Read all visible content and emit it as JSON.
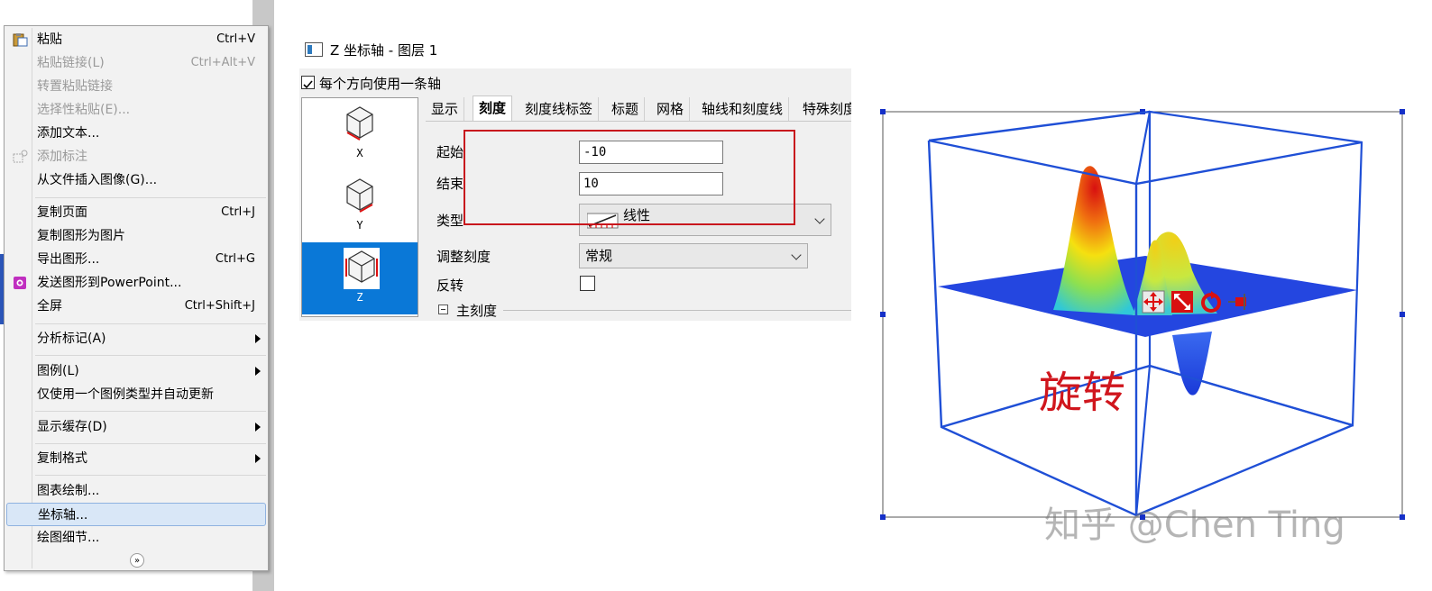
{
  "context_menu": {
    "items": [
      {
        "label": "粘贴",
        "shortcut": "Ctrl+V",
        "disabled": false
      },
      {
        "label": "粘贴链接(L)",
        "shortcut": "Ctrl+Alt+V",
        "disabled": true
      },
      {
        "label": "转置粘贴链接",
        "shortcut": "",
        "disabled": true
      },
      {
        "label": "选择性粘贴(E)...",
        "shortcut": "",
        "disabled": true
      },
      {
        "label": "添加文本...",
        "shortcut": "",
        "disabled": false
      },
      {
        "label": "添加标注",
        "shortcut": "",
        "disabled": true
      },
      {
        "label": "从文件插入图像(G)...",
        "shortcut": "",
        "disabled": false
      },
      {
        "label": "复制页面",
        "shortcut": "Ctrl+J",
        "disabled": false
      },
      {
        "label": "复制图形为图片",
        "shortcut": "",
        "disabled": false
      },
      {
        "label": "导出图形...",
        "shortcut": "Ctrl+G",
        "disabled": false
      },
      {
        "label": "发送图形到PowerPoint...",
        "shortcut": "",
        "disabled": false
      },
      {
        "label": "全屏",
        "shortcut": "Ctrl+Shift+J",
        "disabled": false
      },
      {
        "label": "分析标记(A)",
        "shortcut": "",
        "disabled": false
      },
      {
        "label": "图例(L)",
        "shortcut": "",
        "disabled": false
      },
      {
        "label": "仅使用一个图例类型并自动更新",
        "shortcut": "",
        "disabled": false
      },
      {
        "label": "显示缓存(D)",
        "shortcut": "",
        "disabled": false
      },
      {
        "label": "复制格式",
        "shortcut": "",
        "disabled": false
      },
      {
        "label": "图表绘制...",
        "shortcut": "",
        "disabled": false
      },
      {
        "label": "坐标轴...",
        "shortcut": "",
        "disabled": false,
        "selected": true
      },
      {
        "label": "绘图细节...",
        "shortcut": "",
        "disabled": false
      }
    ],
    "more_glyph": "»"
  },
  "dialog": {
    "title": "Z 坐标轴 - 图层 1",
    "one_per_direction_label": "每个方向使用一条轴",
    "one_per_direction_checked": true,
    "axes": [
      {
        "label": "X",
        "selected": false
      },
      {
        "label": "Y",
        "selected": false
      },
      {
        "label": "Z",
        "selected": true
      }
    ],
    "tabs": [
      "显示",
      "刻度",
      "刻度线标签",
      "标题",
      "网格",
      "轴线和刻度线",
      "特殊刻度"
    ],
    "active_tab": "刻度",
    "fields": {
      "from_label": "起始",
      "from_value": "-10",
      "to_label": "结束",
      "to_value": "10",
      "type_label": "类型",
      "type_value": "线性",
      "rescale_label": "调整刻度",
      "rescale_value": "常规",
      "reverse_label": "反转",
      "reverse_checked": false
    },
    "section_major": "主刻度",
    "highlight_color": "#c8161d"
  },
  "graph": {
    "annotation": "旋转",
    "watermark": "知乎 @Chen Ting",
    "box_color": "#1f4fd6",
    "surface_base_color": "#2446e0",
    "toolbar_icons": [
      "move-icon",
      "resize-icon",
      "rotate-icon",
      "pin-icon"
    ]
  }
}
